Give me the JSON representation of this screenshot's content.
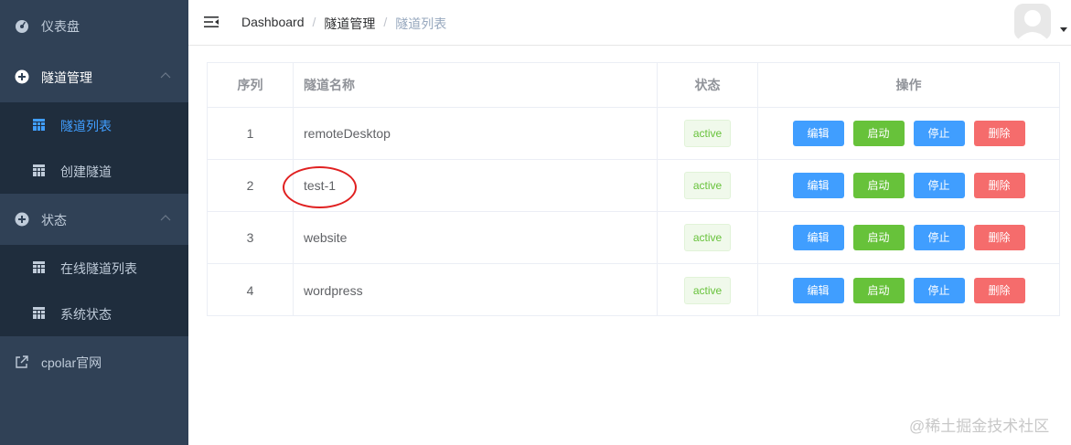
{
  "sidebar": {
    "dashboard_label": "仪表盘",
    "tunnel_mgmt_label": "隧道管理",
    "tunnel_list_label": "隧道列表",
    "create_tunnel_label": "创建隧道",
    "status_label": "状态",
    "online_tunnels_label": "在线隧道列表",
    "system_status_label": "系统状态",
    "cpolar_site_label": "cpolar官网",
    "active_color": "#409eff"
  },
  "header": {
    "breadcrumb": [
      "Dashboard",
      "隧道管理",
      "隧道列表"
    ],
    "separator": "/"
  },
  "table": {
    "columns": [
      "序列",
      "隧道名称",
      "状态",
      "操作"
    ],
    "rows": [
      {
        "index": "1",
        "name": "remoteDesktop",
        "status": "active"
      },
      {
        "index": "2",
        "name": "test-1",
        "status": "active"
      },
      {
        "index": "3",
        "name": "website",
        "status": "active"
      },
      {
        "index": "4",
        "name": "wordpress",
        "status": "active"
      }
    ],
    "actions": {
      "edit": "编辑",
      "start": "启动",
      "stop": "停止",
      "delete": "删除"
    }
  },
  "watermark": "@稀土掘金技术社区"
}
